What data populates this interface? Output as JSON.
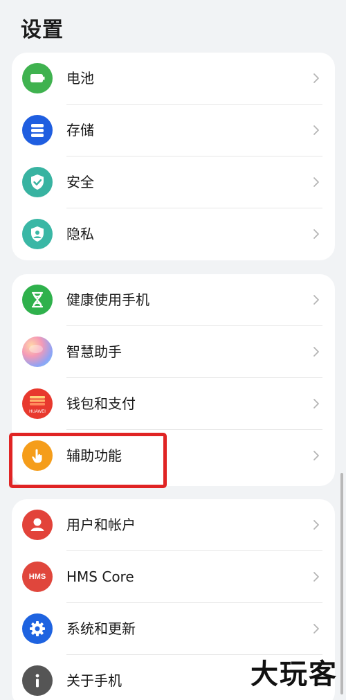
{
  "header": {
    "title": "设置"
  },
  "groups": [
    {
      "items": [
        {
          "label": "电池",
          "icon": "battery-icon",
          "color": "#3fb24f"
        },
        {
          "label": "存储",
          "icon": "storage-icon",
          "color": "#1f5ee0"
        },
        {
          "label": "安全",
          "icon": "shield-check-icon",
          "color": "#38b3a1"
        },
        {
          "label": "隐私",
          "icon": "privacy-shield-icon",
          "color": "#3ab7a5"
        }
      ]
    },
    {
      "items": [
        {
          "label": "健康使用手机",
          "icon": "hourglass-icon",
          "color": "#2fb14c"
        },
        {
          "label": "智慧助手",
          "icon": "assistant-orb-icon",
          "color": "#9b8cf0"
        },
        {
          "label": "钱包和支付",
          "icon": "wallet-icon",
          "color": "#e8392e",
          "badge": "HUAWEI"
        },
        {
          "label": "辅助功能",
          "icon": "accessibility-hand-icon",
          "color": "#f59d1a"
        }
      ]
    },
    {
      "items": [
        {
          "label": "用户和帐户",
          "icon": "user-icon",
          "color": "#e2433a"
        },
        {
          "label": "HMS Core",
          "icon": "hms-icon",
          "color": "#e0463c",
          "badge": "HMS"
        },
        {
          "label": "系统和更新",
          "icon": "gear-icon",
          "color": "#1e63e0"
        },
        {
          "label": "关于手机",
          "icon": "info-icon",
          "color": "#555555"
        }
      ]
    }
  ],
  "watermark": "大玩客"
}
